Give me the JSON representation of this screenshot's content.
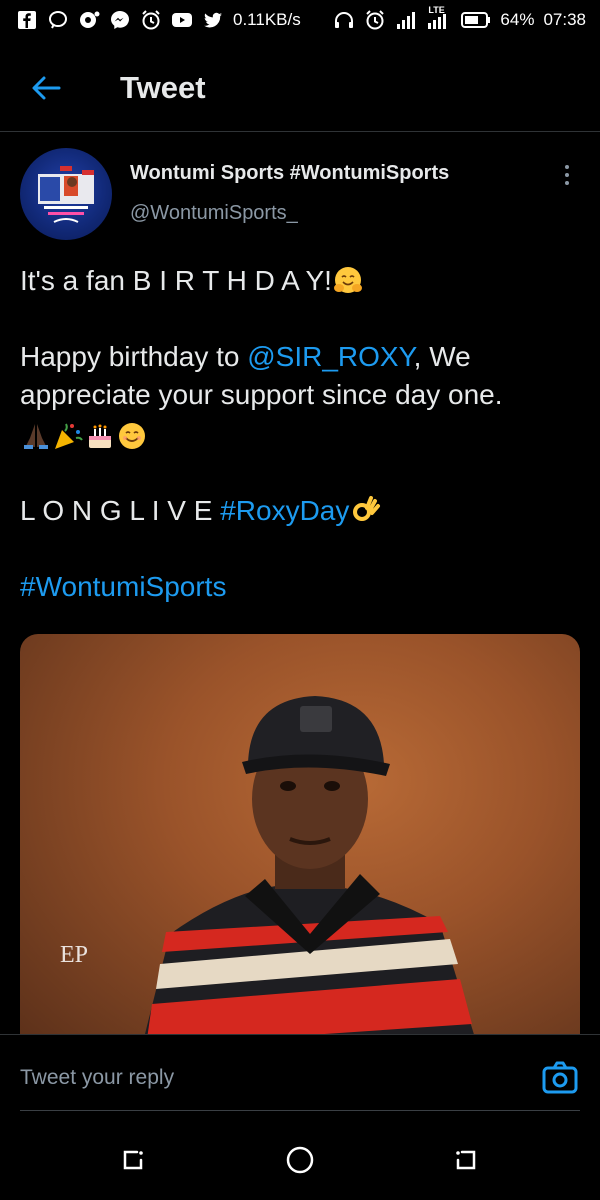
{
  "status_bar": {
    "network_speed": "0.11KB/s",
    "network_type": "LTE",
    "battery_percent": "64%",
    "time": "07:38",
    "icons": [
      "facebook-icon",
      "messenger-bubble-icon",
      "notification-dot-icon",
      "messenger-icon",
      "alarm-icon",
      "youtube-icon",
      "twitter-icon",
      "headphones-icon",
      "alarm-icon",
      "signal-icon",
      "signal-lte-icon",
      "battery-icon"
    ]
  },
  "header": {
    "back_icon": "arrow-left-icon",
    "title": "Tweet"
  },
  "tweet": {
    "author_name": "Wontumi Sports #WontumiSports",
    "author_handle": "@WontumiSports_",
    "line1": "It's a fan B I R T H D A Y!",
    "line2_prefix": "Happy birthday to ",
    "mention": "@SIR_ROXY",
    "line2_suffix": ", We appreciate your support since day one.",
    "line3_prefix": "L O N G L I V E ",
    "hashtag1": "#RoxyDay",
    "hashtag2": "#WontumiSports",
    "emojis": [
      "hugging-face-emoji",
      "praying-hands-emoji",
      "party-popper-emoji",
      "birthday-cake-emoji",
      "smiling-face-emoji",
      "ok-hand-emoji"
    ],
    "media_watermark": "EP"
  },
  "reply": {
    "placeholder": "Tweet your reply",
    "camera_icon": "camera-icon"
  },
  "colors": {
    "background": "#000000",
    "link": "#1d9bf0",
    "text": "#e7e9ea",
    "muted": "#8b98a5"
  },
  "nav": [
    "recent-apps-icon",
    "home-icon",
    "back-icon"
  ]
}
